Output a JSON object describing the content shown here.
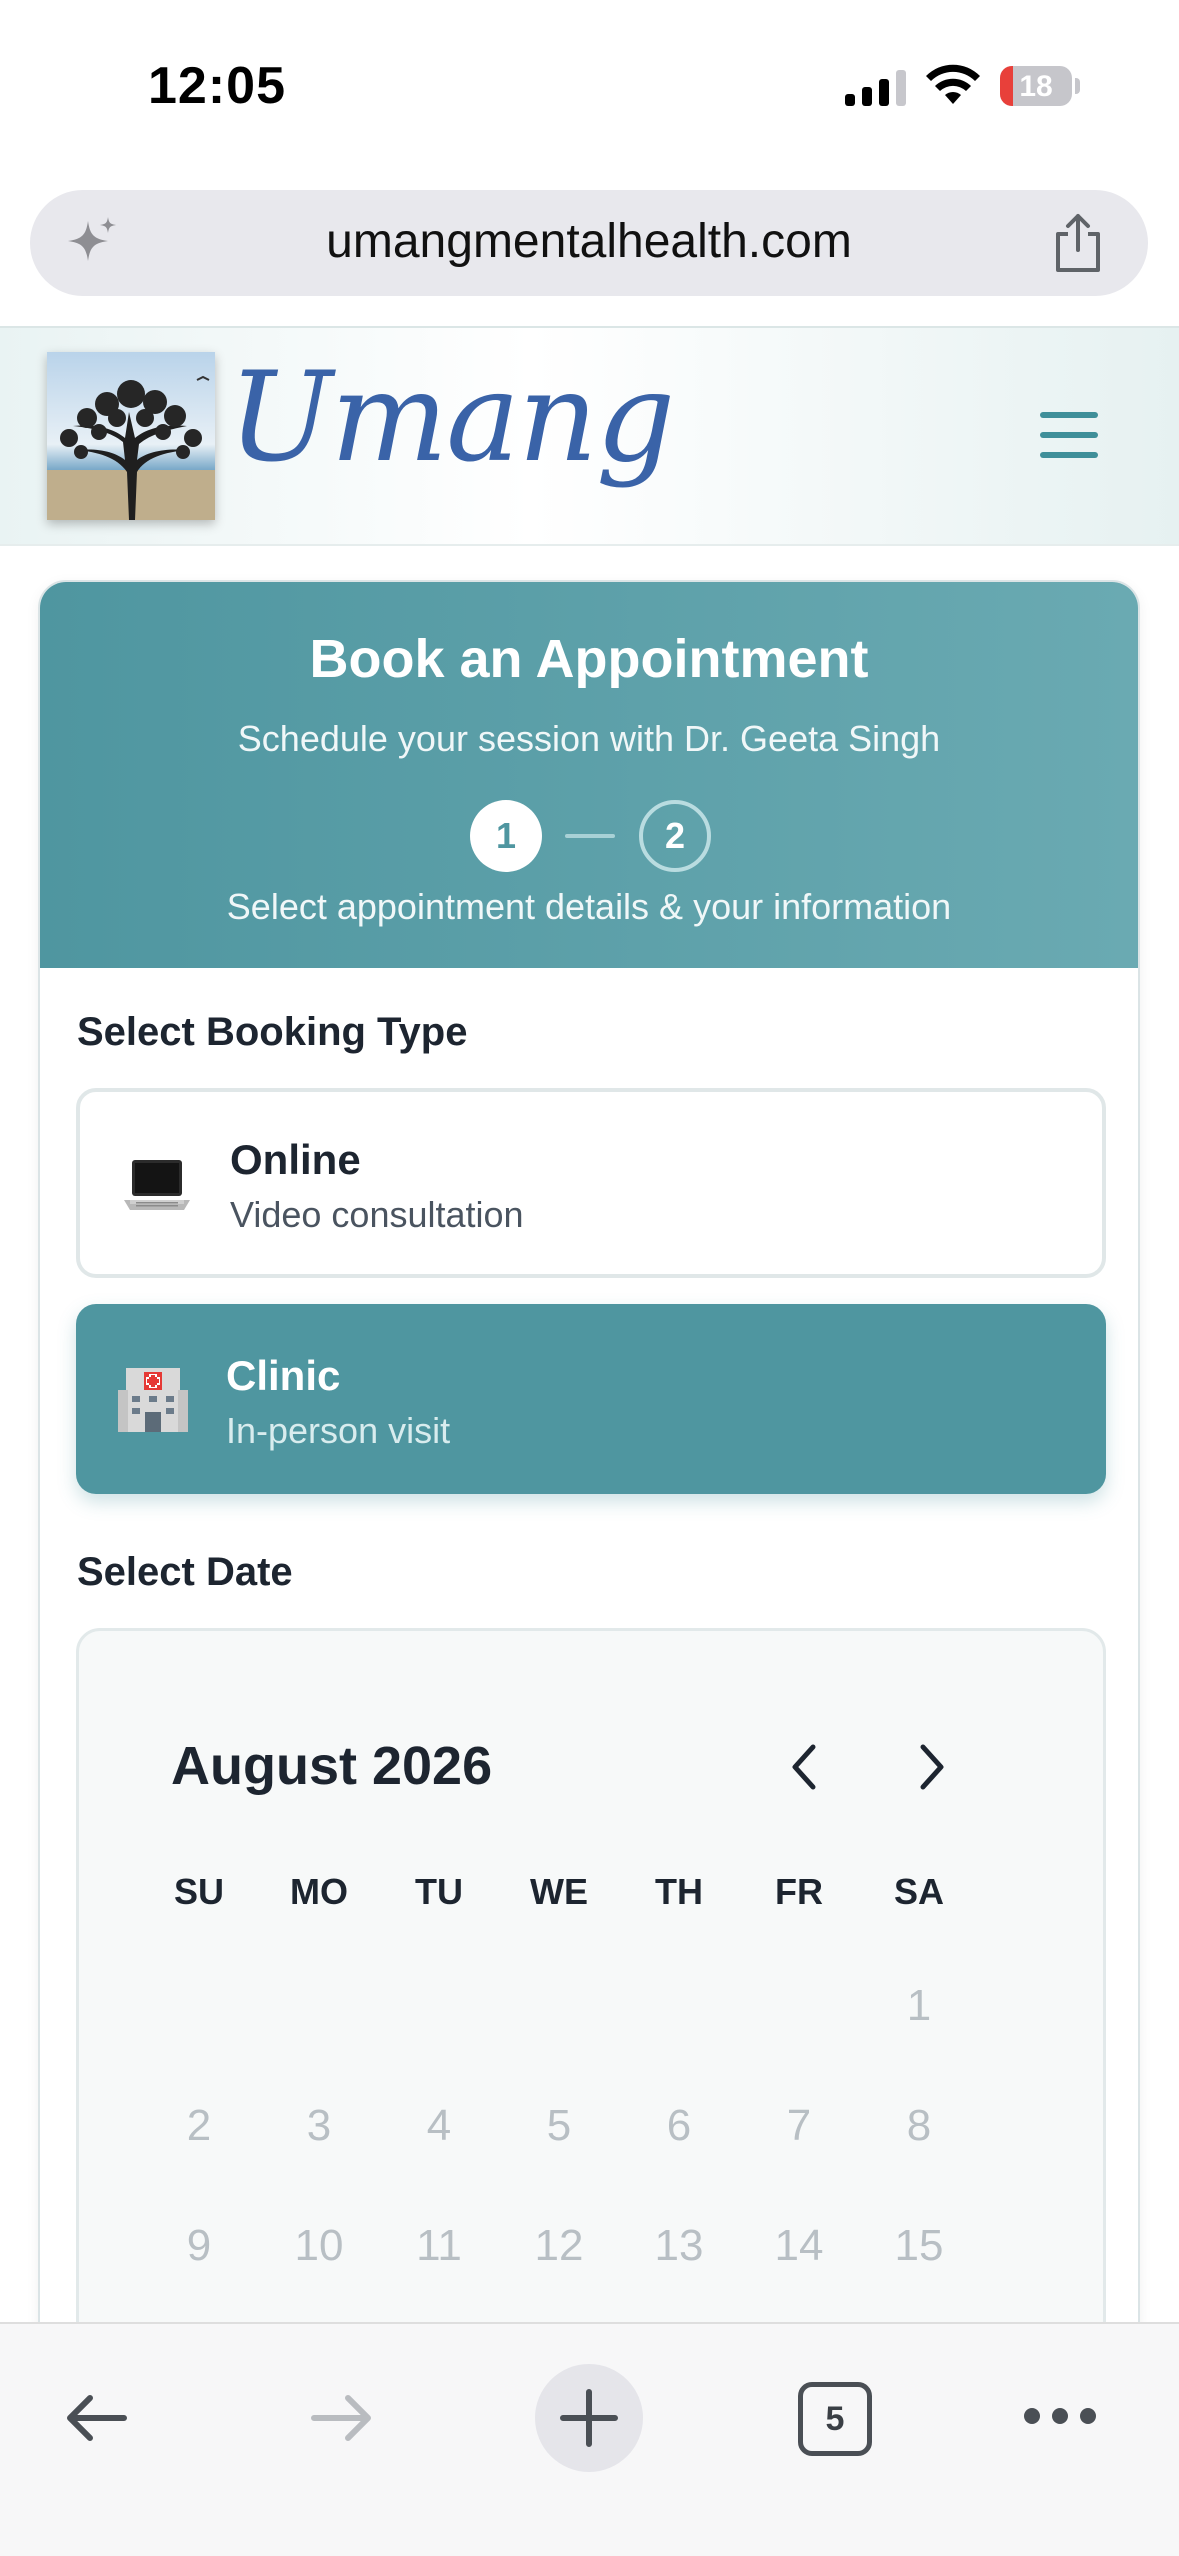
{
  "status_bar": {
    "time": "12:05",
    "battery_level": "18",
    "icons": [
      "cellular-signal-icon",
      "wifi-icon",
      "battery-icon"
    ]
  },
  "browser": {
    "url": "umangmentalhealth.com",
    "tab_count": "5",
    "icons": [
      "sparkle-icon",
      "share-icon",
      "back-arrow-icon",
      "forward-arrow-icon",
      "plus-icon",
      "tabs-icon",
      "more-icon"
    ]
  },
  "site": {
    "brand": "Umang",
    "brand_color": "#3a63a8",
    "accent_color": "#4f96a0"
  },
  "booking": {
    "title": "Book an Appointment",
    "subtitle": "Schedule your session with Dr. Geeta Singh",
    "steps": [
      "1",
      "2"
    ],
    "current_step": 1,
    "step_caption": "Select appointment details & your information",
    "type_label": "Select Booking Type",
    "options": [
      {
        "icon": "laptop-icon",
        "title": "Online",
        "description": "Video consultation",
        "selected": false
      },
      {
        "icon": "hospital-icon",
        "title": "Clinic",
        "description": "In-person visit",
        "selected": true
      }
    ],
    "date_label": "Select Date"
  },
  "calendar": {
    "month": "August 2026",
    "weekdays": [
      "SU",
      "MO",
      "TU",
      "WE",
      "TH",
      "FR",
      "SA"
    ],
    "weeks": [
      [
        "",
        "",
        "",
        "",
        "",
        "",
        "1"
      ],
      [
        "2",
        "3",
        "4",
        "5",
        "6",
        "7",
        "8"
      ],
      [
        "9",
        "10",
        "11",
        "12",
        "13",
        "14",
        "15"
      ]
    ]
  }
}
